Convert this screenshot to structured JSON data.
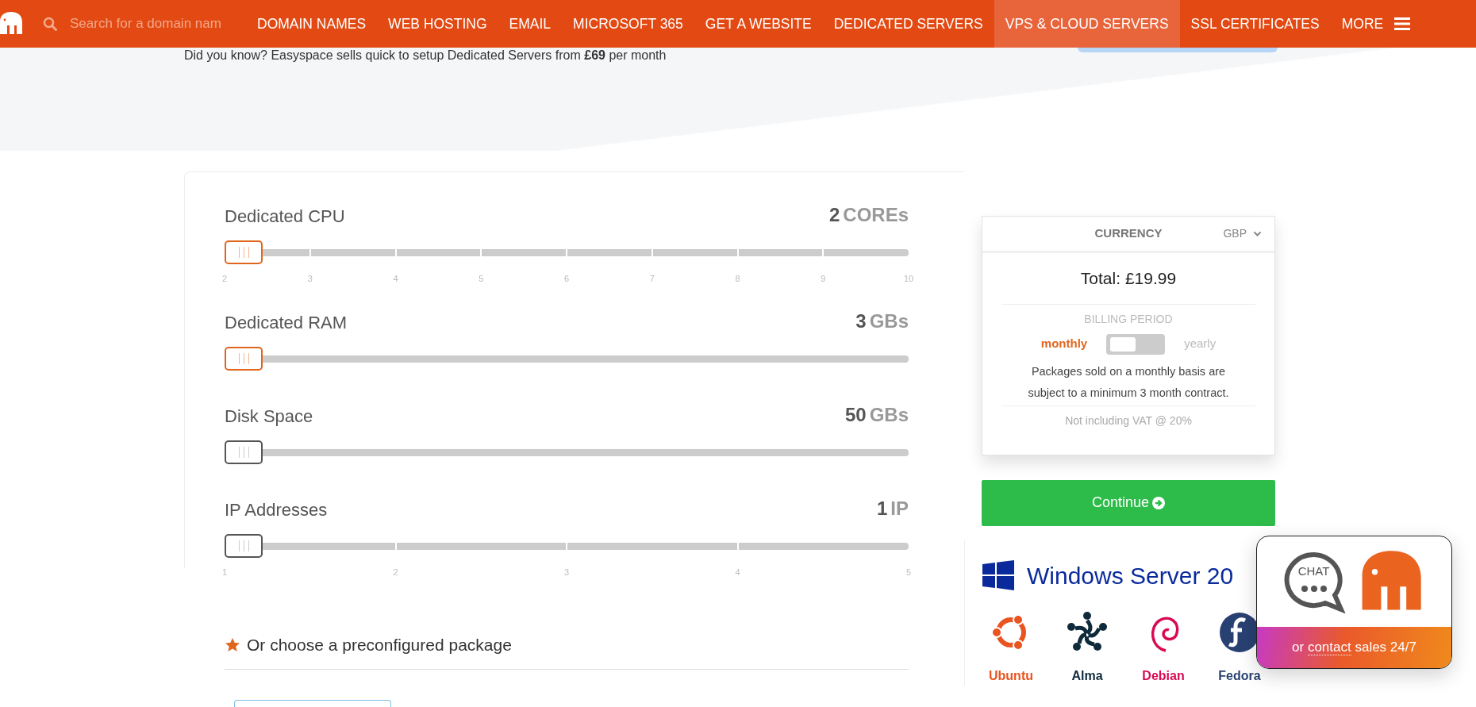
{
  "header": {
    "search": {
      "placeholder": "Search for a domain nam"
    },
    "nav": [
      {
        "label": "DOMAIN NAMES",
        "selected": false
      },
      {
        "label": "WEB HOSTING",
        "selected": false
      },
      {
        "label": "EMAIL",
        "selected": false
      },
      {
        "label": "MICROSOFT 365",
        "selected": false
      },
      {
        "label": "GET A WEBSITE",
        "selected": false
      },
      {
        "label": "DEDICATED SERVERS",
        "selected": false
      },
      {
        "label": "VPS & CLOUD SERVERS",
        "selected": true
      },
      {
        "label": "SSL CERTIFICATES",
        "selected": false
      },
      {
        "label": "MORE",
        "selected": false
      }
    ]
  },
  "notice": "Did you know? Easyspace sells quick to setup Dedicated Servers from **£69** per month",
  "sliders": [
    {
      "label": "Dedicated CPU",
      "value": "2",
      "unit": "COREs",
      "level": 0,
      "accent": true,
      "ticks": [
        "2",
        "3",
        "4",
        "5",
        "6",
        "7",
        "8",
        "9",
        "10"
      ]
    },
    {
      "label": "Dedicated RAM",
      "value": "3",
      "unit": "GBs",
      "level": 0,
      "accent": true
    },
    {
      "label": "Disk Space",
      "value": "50",
      "unit": "GBs",
      "level": 0,
      "accent": false
    },
    {
      "label": "IP Addresses",
      "value": "1",
      "unit": "IP",
      "level": 0,
      "accent": false,
      "ticks": [
        "1",
        "2",
        "3",
        "4",
        "5"
      ]
    }
  ],
  "preconfigured": {
    "title": "Or choose a preconfigured package"
  },
  "summary": {
    "currency_label": "CURRENCY",
    "currency": "GBP",
    "total": "Total: £19.99",
    "billing_label": "BILLING PERIOD",
    "billing_options": [
      {
        "label": "monthly",
        "selected": true
      },
      {
        "label": "yearly",
        "selected": false
      }
    ],
    "note": "Packages sold on a monthly basis are subject to a minimum 3 month contract.",
    "vat": "Not including VAT @ 20%",
    "button": "Continue"
  },
  "os": {
    "title": "Windows Server 20",
    "items": [
      {
        "label": "Ubuntu",
        "color": "#e95420"
      },
      {
        "label": "Alma",
        "color": "#0f2a3a"
      },
      {
        "label": "Debian",
        "color": "#d70a53"
      },
      {
        "label": "Fedora",
        "color": "#294172"
      }
    ]
  },
  "chat": {
    "bubble": "CHAT",
    "before": "or",
    "link": "contact",
    "after": "sales 24/7"
  }
}
